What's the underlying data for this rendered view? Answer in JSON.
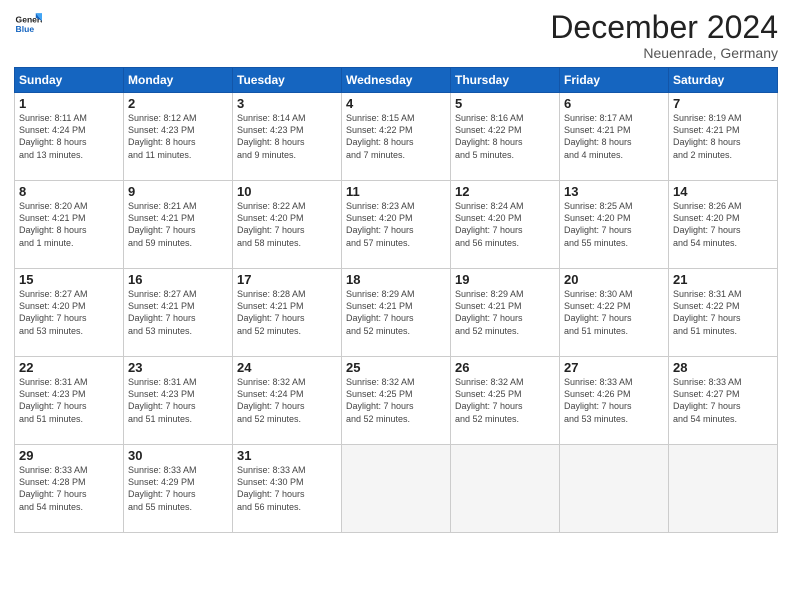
{
  "header": {
    "logo_general": "General",
    "logo_blue": "Blue",
    "month_title": "December 2024",
    "location": "Neuenrade, Germany"
  },
  "days_of_week": [
    "Sunday",
    "Monday",
    "Tuesday",
    "Wednesday",
    "Thursday",
    "Friday",
    "Saturday"
  ],
  "weeks": [
    [
      {
        "day": 1,
        "info": "Sunrise: 8:11 AM\nSunset: 4:24 PM\nDaylight: 8 hours\nand 13 minutes."
      },
      {
        "day": 2,
        "info": "Sunrise: 8:12 AM\nSunset: 4:23 PM\nDaylight: 8 hours\nand 11 minutes."
      },
      {
        "day": 3,
        "info": "Sunrise: 8:14 AM\nSunset: 4:23 PM\nDaylight: 8 hours\nand 9 minutes."
      },
      {
        "day": 4,
        "info": "Sunrise: 8:15 AM\nSunset: 4:22 PM\nDaylight: 8 hours\nand 7 minutes."
      },
      {
        "day": 5,
        "info": "Sunrise: 8:16 AM\nSunset: 4:22 PM\nDaylight: 8 hours\nand 5 minutes."
      },
      {
        "day": 6,
        "info": "Sunrise: 8:17 AM\nSunset: 4:21 PM\nDaylight: 8 hours\nand 4 minutes."
      },
      {
        "day": 7,
        "info": "Sunrise: 8:19 AM\nSunset: 4:21 PM\nDaylight: 8 hours\nand 2 minutes."
      }
    ],
    [
      {
        "day": 8,
        "info": "Sunrise: 8:20 AM\nSunset: 4:21 PM\nDaylight: 8 hours\nand 1 minute."
      },
      {
        "day": 9,
        "info": "Sunrise: 8:21 AM\nSunset: 4:21 PM\nDaylight: 7 hours\nand 59 minutes."
      },
      {
        "day": 10,
        "info": "Sunrise: 8:22 AM\nSunset: 4:20 PM\nDaylight: 7 hours\nand 58 minutes."
      },
      {
        "day": 11,
        "info": "Sunrise: 8:23 AM\nSunset: 4:20 PM\nDaylight: 7 hours\nand 57 minutes."
      },
      {
        "day": 12,
        "info": "Sunrise: 8:24 AM\nSunset: 4:20 PM\nDaylight: 7 hours\nand 56 minutes."
      },
      {
        "day": 13,
        "info": "Sunrise: 8:25 AM\nSunset: 4:20 PM\nDaylight: 7 hours\nand 55 minutes."
      },
      {
        "day": 14,
        "info": "Sunrise: 8:26 AM\nSunset: 4:20 PM\nDaylight: 7 hours\nand 54 minutes."
      }
    ],
    [
      {
        "day": 15,
        "info": "Sunrise: 8:27 AM\nSunset: 4:20 PM\nDaylight: 7 hours\nand 53 minutes."
      },
      {
        "day": 16,
        "info": "Sunrise: 8:27 AM\nSunset: 4:21 PM\nDaylight: 7 hours\nand 53 minutes."
      },
      {
        "day": 17,
        "info": "Sunrise: 8:28 AM\nSunset: 4:21 PM\nDaylight: 7 hours\nand 52 minutes."
      },
      {
        "day": 18,
        "info": "Sunrise: 8:29 AM\nSunset: 4:21 PM\nDaylight: 7 hours\nand 52 minutes."
      },
      {
        "day": 19,
        "info": "Sunrise: 8:29 AM\nSunset: 4:21 PM\nDaylight: 7 hours\nand 52 minutes."
      },
      {
        "day": 20,
        "info": "Sunrise: 8:30 AM\nSunset: 4:22 PM\nDaylight: 7 hours\nand 51 minutes."
      },
      {
        "day": 21,
        "info": "Sunrise: 8:31 AM\nSunset: 4:22 PM\nDaylight: 7 hours\nand 51 minutes."
      }
    ],
    [
      {
        "day": 22,
        "info": "Sunrise: 8:31 AM\nSunset: 4:23 PM\nDaylight: 7 hours\nand 51 minutes."
      },
      {
        "day": 23,
        "info": "Sunrise: 8:31 AM\nSunset: 4:23 PM\nDaylight: 7 hours\nand 51 minutes."
      },
      {
        "day": 24,
        "info": "Sunrise: 8:32 AM\nSunset: 4:24 PM\nDaylight: 7 hours\nand 52 minutes."
      },
      {
        "day": 25,
        "info": "Sunrise: 8:32 AM\nSunset: 4:25 PM\nDaylight: 7 hours\nand 52 minutes."
      },
      {
        "day": 26,
        "info": "Sunrise: 8:32 AM\nSunset: 4:25 PM\nDaylight: 7 hours\nand 52 minutes."
      },
      {
        "day": 27,
        "info": "Sunrise: 8:33 AM\nSunset: 4:26 PM\nDaylight: 7 hours\nand 53 minutes."
      },
      {
        "day": 28,
        "info": "Sunrise: 8:33 AM\nSunset: 4:27 PM\nDaylight: 7 hours\nand 54 minutes."
      }
    ],
    [
      {
        "day": 29,
        "info": "Sunrise: 8:33 AM\nSunset: 4:28 PM\nDaylight: 7 hours\nand 54 minutes."
      },
      {
        "day": 30,
        "info": "Sunrise: 8:33 AM\nSunset: 4:29 PM\nDaylight: 7 hours\nand 55 minutes."
      },
      {
        "day": 31,
        "info": "Sunrise: 8:33 AM\nSunset: 4:30 PM\nDaylight: 7 hours\nand 56 minutes."
      },
      null,
      null,
      null,
      null
    ]
  ]
}
